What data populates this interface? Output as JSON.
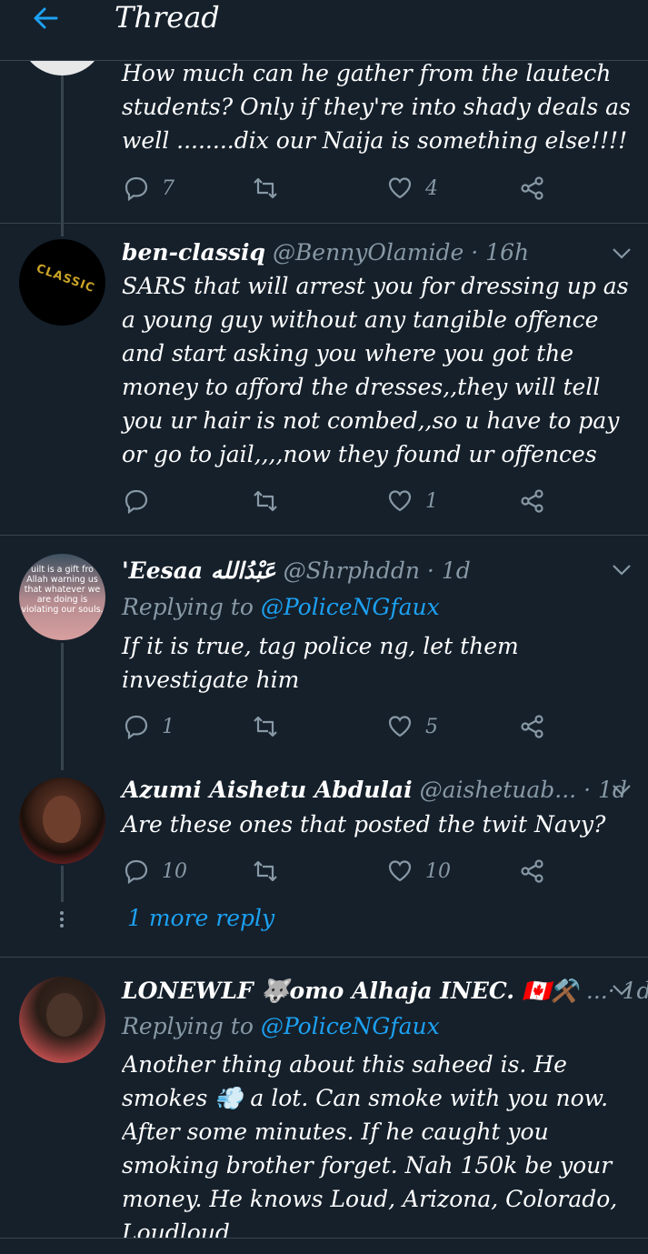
{
  "header": {
    "title": "Thread"
  },
  "colors": {
    "background": "#15202b",
    "accent": "#1da1f2",
    "muted": "#8899a6",
    "divider": "#38444d"
  },
  "tweets": [
    {
      "avatar_text": "",
      "body": "How much can he gather from the lautech students? Only if they're into shady deals as well ........dix our Naija is something else!!!!",
      "replies": "7",
      "retweets": "",
      "likes": "4"
    },
    {
      "name": "ben-classiq",
      "handle": "@BennyOlamide · 16h",
      "avatar_text": "CLASSIC",
      "body": "SARS that will arrest you for dressing up as a young guy without any tangible offence and start asking you where you got the money to afford the dresses,,they will tell you ur hair is not combed,,so u have to pay or go to jail,,,,now they found ur offences",
      "replies": "",
      "retweets": "",
      "likes": "1"
    },
    {
      "name": "'Eesaa عَبْدُالله",
      "handle": "@Shrphddn · 1d",
      "avatar_text": "uilt is a gift fro Allah warning us that whatever we are doing is violating our souls.",
      "reply_prefix": "Replying to ",
      "reply_mention": "@PoliceNGfaux",
      "body": "If it is true, tag police ng, let them investigate him",
      "replies": "1",
      "retweets": "",
      "likes": "5"
    },
    {
      "name": "Azumi Aishetu Abdulai",
      "handle": "@aishetuab...  · 1d",
      "body": "Are these ones that posted the twit Navy?",
      "replies": "10",
      "retweets": "",
      "likes": "10"
    },
    {
      "name": "LONEWLF 🐺omo Alhaja INEC. 🇨🇦⚒️",
      "handle": "...· 1d",
      "reply_prefix": "Replying to ",
      "reply_mention": "@PoliceNGfaux",
      "body": "Another thing about this saheed is. He smokes 💨 a lot. Can smoke with you now. After some minutes. If he caught you smoking brother forget. Nah 150k be your money. He knows Loud, Arizona, Colorado, Loudloud."
    }
  ],
  "more_replies": "1 more reply"
}
